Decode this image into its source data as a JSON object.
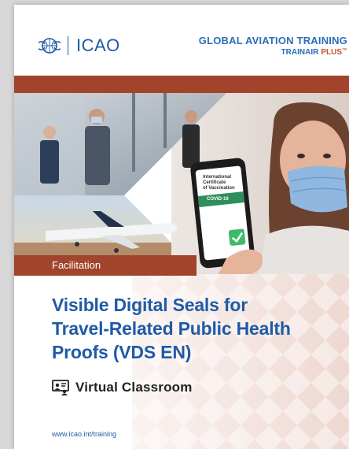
{
  "header": {
    "logo_text": "ICAO",
    "program_title": "GLOBAL AVIATION TRAINING",
    "program_sub_trainair": "TRAINAIR",
    "program_sub_plus": "PLUS",
    "program_sub_tm": "™"
  },
  "course": {
    "category": "Facilitation",
    "title_line1": "Visible Digital Seals for",
    "title_line2": "Travel-Related Public Health",
    "title_line3": "Proofs (VDS EN)",
    "delivery": "Virtual Classroom",
    "url": "www.icao.int/training"
  },
  "phone_screen": {
    "line1": "International",
    "line2": "Certificate",
    "line3": "of Vaccination",
    "line4": "COVID-19"
  },
  "icons": {
    "logo": "icao-emblem-icon",
    "delivery": "virtual-classroom-icon",
    "check": "check-icon"
  },
  "colors": {
    "brand_blue": "#1f5aa8",
    "band_red": "#a2432c",
    "plus_orange": "#c8502f"
  }
}
